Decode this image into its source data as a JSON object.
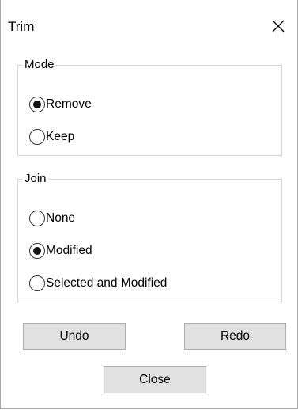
{
  "window": {
    "title": "Trim"
  },
  "mode_group": {
    "legend": "Mode",
    "options": [
      {
        "label": "Remove",
        "checked": true
      },
      {
        "label": "Keep",
        "checked": false
      }
    ]
  },
  "join_group": {
    "legend": "Join",
    "options": [
      {
        "label": "None",
        "checked": false
      },
      {
        "label": "Modified",
        "checked": true
      },
      {
        "label": "Selected and Modified",
        "checked": false
      }
    ]
  },
  "buttons": {
    "undo": "Undo",
    "redo": "Redo",
    "close": "Close"
  },
  "icons": {
    "close": "close-icon",
    "radio_selected": "radio-selected-icon",
    "radio_unselected": "radio-unselected-icon"
  },
  "colors": {
    "button_face": "#e1e1e1",
    "button_border": "#adadad",
    "group_border": "#d6d6d6",
    "window_border": "#aaaaaa"
  }
}
